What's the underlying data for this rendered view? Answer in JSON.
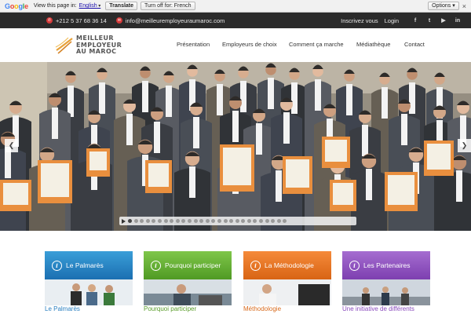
{
  "translate_bar": {
    "logo": "Google",
    "prompt": "View this page in:",
    "language": "English",
    "translate_label": "Translate",
    "turn_off_label": "Turn off for: French",
    "options_label": "Options",
    "close_label": "×"
  },
  "topbar": {
    "phone": "+212 5 37 68 36 14",
    "email": "info@meilleuremployeuraumaroc.com",
    "register": "Inscrivez vous",
    "login": "Login",
    "social": {
      "facebook": "f",
      "twitter": "t",
      "youtube": "▶",
      "linkedin": "in"
    }
  },
  "logo": {
    "line1": "MEILLEUR",
    "line2": "EMPLOYEUR",
    "line3": "AU MAROC"
  },
  "nav": {
    "presentation": "Présentation",
    "employers": "Employeurs de choix",
    "how": "Comment ça marche",
    "media": "Médiathèque",
    "contact": "Contact"
  },
  "slider": {
    "arrow_left": "❮",
    "arrow_right": "❯",
    "dot_count": 27,
    "active_dot": 0
  },
  "boxes": [
    {
      "title": "Le Palmarès",
      "caption": "Le Palmarès",
      "color": "#1b6fb1"
    },
    {
      "title": "Pourquoi participer",
      "caption": "Pourquoi participer",
      "color": "#4f9a23"
    },
    {
      "title": "La Méthodologie",
      "caption": "Méthodologie",
      "color": "#d86414"
    },
    {
      "title": "Les Partenaires",
      "caption": "Une initiative de différents",
      "color": "#7d3fb0"
    }
  ],
  "colors": {
    "topbar": "#2b2b2b",
    "icon_red": "#d43a3a",
    "award_orange": "#e8862e"
  }
}
